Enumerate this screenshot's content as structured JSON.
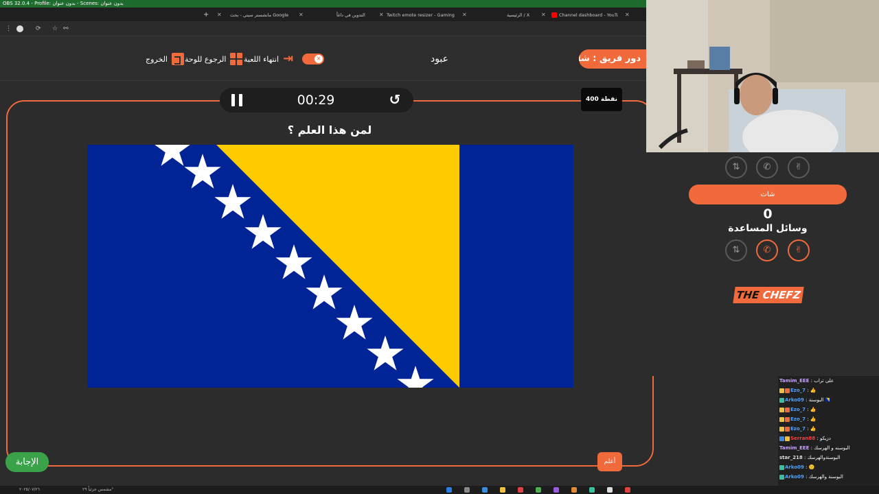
{
  "obs": {
    "title": "OBS 32.0.4 - Profile: بدون عنوان - Scenes: بدون عنوان"
  },
  "browser": {
    "tabs": [
      {
        "label": "Channel dashboard - YouTube",
        "color": "#ff0000"
      },
      {
        "label": "الرئيسية / X",
        "color": "#ffffff"
      },
      {
        "label": "Twitch emote resizer - Gaming",
        "color": "#ff4444"
      },
      {
        "label": "التدوين في داغاً",
        "color": "#888888"
      },
      {
        "label": "مانشستر سيتي - بحث Google",
        "color": "#4caf50"
      }
    ],
    "new_tab": "+"
  },
  "header": {
    "exit_label": "الخروج",
    "board_label": "الرجوع للوحة",
    "end_game_label": "انتهاء اللعبة",
    "player_name": "عبود",
    "team_label": "دور فريق : شات"
  },
  "game": {
    "timer": "00:29",
    "points": "400 نقطة",
    "question": "لمن هذا العلم ؟",
    "answer_label": "الإجابة",
    "know_label": "أعلم"
  },
  "side": {
    "chat_label": "شات",
    "score": "0",
    "aids_label": "وسائل المساعدة",
    "logo_part1": "THE",
    "logo_part2": "CHEFZ"
  },
  "chat": {
    "messages": [
      {
        "user": "Tamim_EEE",
        "text": ": على تراب",
        "color": "#c8a2ff"
      },
      {
        "user": "Ezo_7",
        "text": ": 👍",
        "color": "#4da3ff"
      },
      {
        "user": "Arko09",
        "text": ": البوسنة 🇧🇦",
        "color": "#4da3ff"
      },
      {
        "user": "Ezo_7",
        "text": ": 👍",
        "color": "#4da3ff"
      },
      {
        "user": "Ezo_7",
        "text": ": 👍",
        "color": "#4da3ff"
      },
      {
        "user": "Ezo_7",
        "text": ": 👍",
        "color": "#4da3ff"
      },
      {
        "user": "Serran88",
        "text": ": دزيكو",
        "color": "#ff3b3b"
      },
      {
        "user": "Tamim_EEE",
        "text": ": البوسنه و الهرسك",
        "color": "#c8a2ff"
      },
      {
        "user": "star_218",
        "text": ": البوسنةوالهرسك",
        "color": "#dddddd"
      },
      {
        "user": "Arko09",
        "text": ": 🙂",
        "color": "#4da3ff"
      },
      {
        "user": "Arko09",
        "text": ": البوسنة والهرسك",
        "color": "#4da3ff"
      }
    ]
  },
  "taskbar": {
    "weather": "مشمس جزئياً ٢٩°",
    "date": "٢٠٢٥/٠٧/٢٦"
  },
  "colors": {
    "accent": "#f06a3c",
    "answer": "#3aa34a",
    "flag_blue": "#002395",
    "flag_yellow": "#fecb00"
  }
}
